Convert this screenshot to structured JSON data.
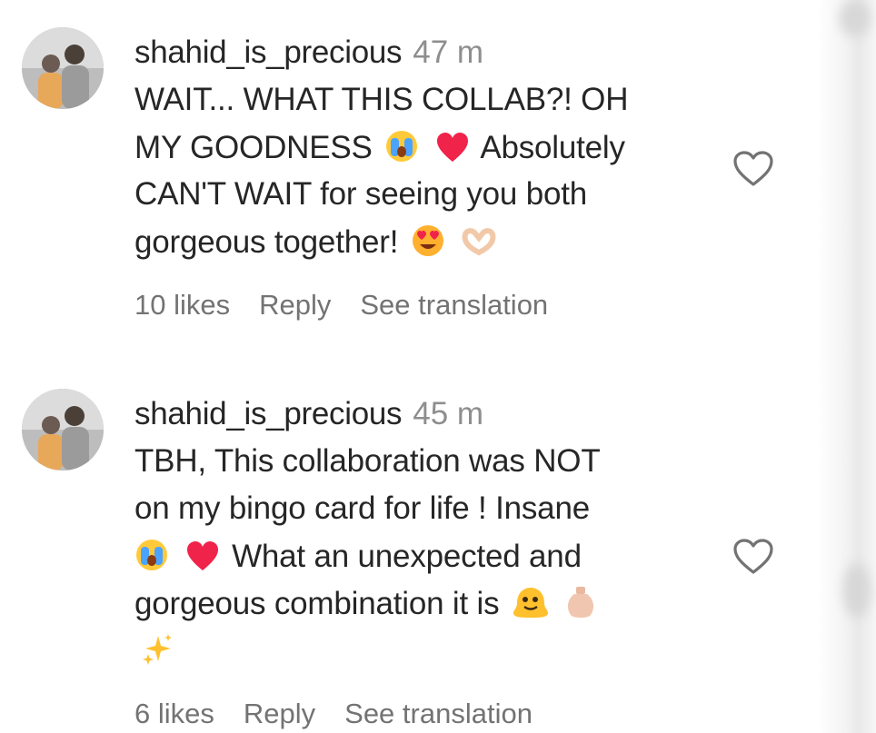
{
  "comments": [
    {
      "username": "shahid_is_precious",
      "time": "47 m",
      "lines": [
        "WAIT... WHAT THIS COLLAB?! OH",
        "MY GOODNESS",
        "Absolutely",
        "CAN'T WAIT for seeing you both",
        "gorgeous together!"
      ],
      "likes": "10 likes",
      "reply": "Reply",
      "translate": "See translation"
    },
    {
      "username": "shahid_is_precious",
      "time": "45 m",
      "lines": [
        "TBH, This collaboration was NOT",
        "on my bingo card for life ! Insane",
        "What an unexpected and",
        "gorgeous combination it is"
      ],
      "likes": "6 likes",
      "reply": "Reply",
      "translate": "See translation"
    }
  ],
  "icons": {
    "like": "heart-outline-icon",
    "emoji_crying": "loudly-crying-face-emoji",
    "emoji_heart": "red-heart-emoji",
    "emoji_heart_eyes": "heart-eyes-emoji",
    "emoji_hand_heart": "heart-hands-emoji",
    "emoji_melting": "melting-face-emoji",
    "emoji_vase": "vase-emoji",
    "emoji_sparkles": "sparkles-emoji"
  },
  "colors": {
    "text": "#262626",
    "secondary": "#8e8e8e",
    "meta": "#737373",
    "heart": "#e0245e"
  }
}
